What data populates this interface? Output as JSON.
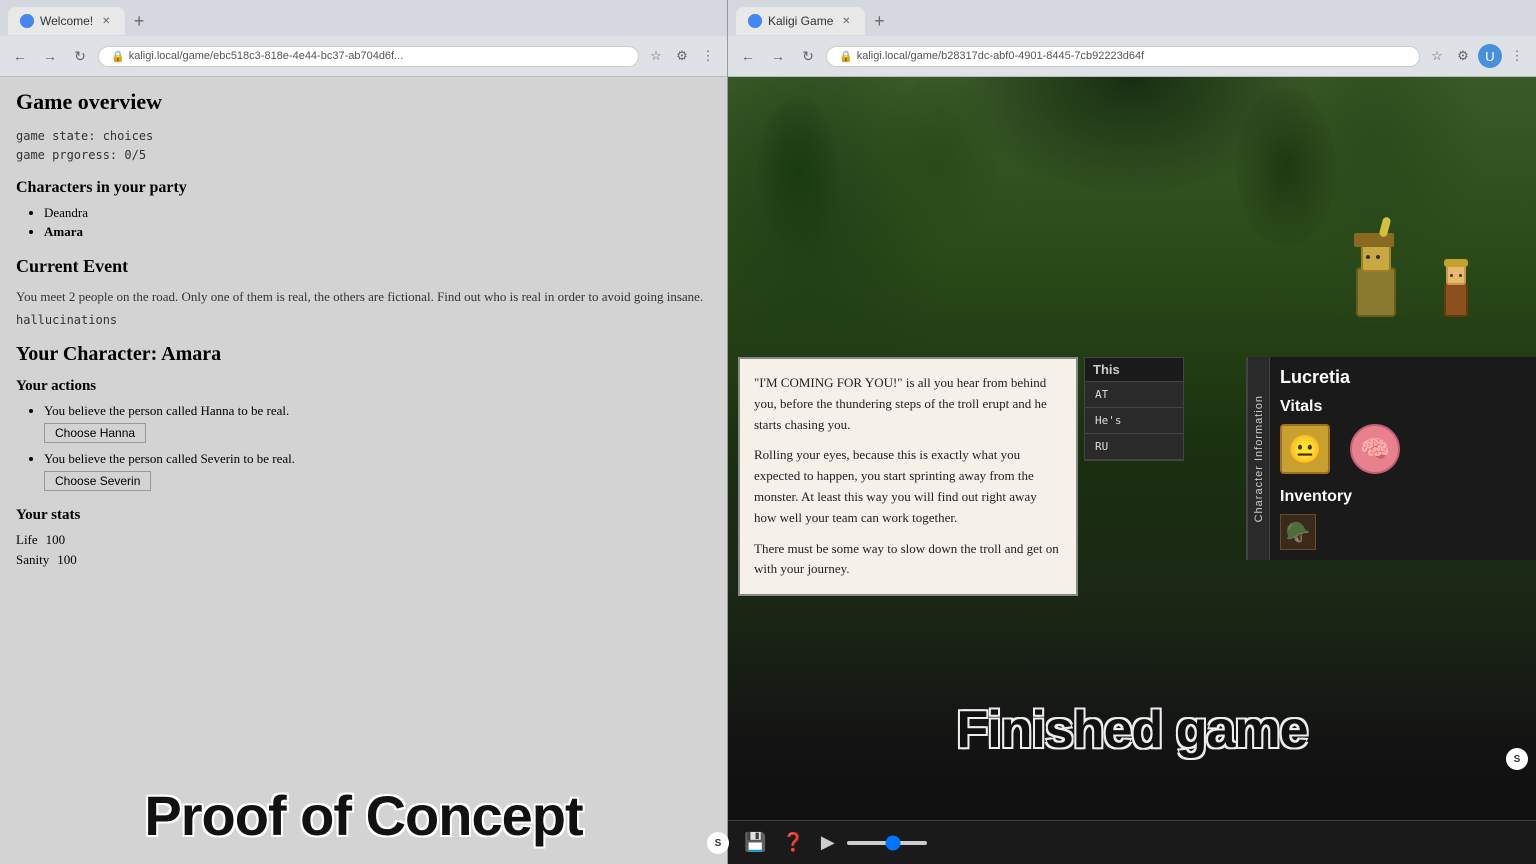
{
  "left_browser": {
    "tab_title": "Welcome!",
    "url": "kaligi.local/game/ebc518c3-818e-4e44-bc37-ab704d6f...",
    "page": {
      "title": "Game overview",
      "game_state_label": "game state: choices",
      "game_progress_label": "game prgoress: 0/5",
      "party_section": "Characters in your party",
      "party_members": [
        "Deandra",
        "Amara"
      ],
      "current_event_section": "Current Event",
      "event_description": "You meet 2 people on the road. Only one of them is real, the others are fictional. Find out who is real in order to avoid going insane.",
      "event_tag": "hallucinations",
      "character_section": "Your Character: Amara",
      "actions_section": "Your actions",
      "actions": [
        {
          "text": "You believe the person called Hanna to be real.",
          "button": "Choose Hanna"
        },
        {
          "text": "You believe the person called Severin to be real.",
          "button": "Choose Severin"
        }
      ],
      "stats_section": "Your stats",
      "stats": [
        {
          "label": "Life",
          "value": "100"
        },
        {
          "label": "Sanity",
          "value": "100"
        }
      ]
    },
    "watermark": "Proof of Concept"
  },
  "right_browser": {
    "tab_title": "Kaligi Game",
    "url": "kaligi.local/game/b28317dc-abf0-4901-8445-7cb92223d64f",
    "dialog": {
      "lines": [
        "\"I'M COMING FOR YOU!\" is all you hear from behind you, before the thundering steps of the troll erupt and he starts chasing you.",
        "Rolling your eyes, because this is exactly what you expected to happen, you start sprinting away from the monster. At least this way you will find out right away how well your team can work together.",
        "There must be some way to slow down the troll and get on with your journey."
      ]
    },
    "action_panel": {
      "this_label": "This",
      "at_label": "AT",
      "hes_label": "He's",
      "ru_label": "RU"
    },
    "char_info": {
      "tab_label": "Character Information",
      "name": "Lucretia",
      "vitals_section": "Vitals",
      "inventory_section": "Inventory"
    },
    "watermark": "Finished game"
  }
}
